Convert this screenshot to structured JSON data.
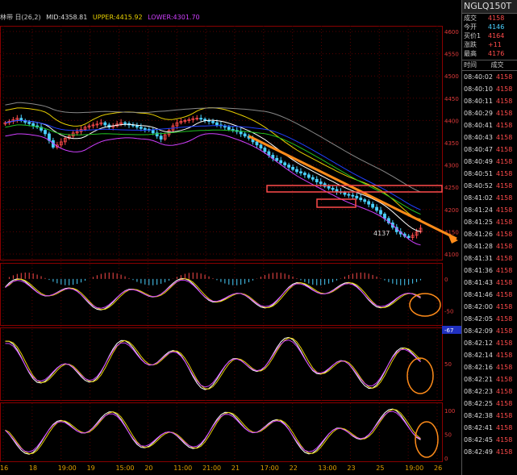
{
  "header": {
    "indicator": "林带 日(26,2)",
    "mid": "MID:4358.81",
    "upper": "UPPER:4415.92",
    "lower": "LOWER:4301.70"
  },
  "quote": {
    "symbol": "NGLQ150T",
    "fields": [
      {
        "label": "成交",
        "value": "4158",
        "color": "#ff4b4b"
      },
      {
        "label": "今开",
        "value": "4146",
        "color": "#4ad0ff"
      },
      {
        "label": "买价1",
        "value": "4164",
        "color": "#ff4b4b"
      },
      {
        "label": "涨跌",
        "value": "+11",
        "color": "#ff4b4b"
      },
      {
        "label": "最高",
        "value": "4176",
        "color": "#ff4b4b"
      }
    ],
    "col_time": "时间",
    "col_trade": "成交",
    "trades": [
      {
        "time": "08:40:02",
        "price": "4158"
      },
      {
        "time": "08:40:10",
        "price": "4158"
      },
      {
        "time": "08:40:11",
        "price": "4158"
      },
      {
        "time": "08:40:29",
        "price": "4158"
      },
      {
        "time": "08:40:41",
        "price": "4158"
      },
      {
        "time": "08:40:43",
        "price": "4158"
      },
      {
        "time": "08:40:47",
        "price": "4158"
      },
      {
        "time": "08:40:49",
        "price": "4158"
      },
      {
        "time": "08:40:51",
        "price": "4158"
      },
      {
        "time": "08:40:52",
        "price": "4158"
      },
      {
        "time": "08:41:02",
        "price": "4158"
      },
      {
        "time": "08:41:24",
        "price": "4158"
      },
      {
        "time": "08:41:25",
        "price": "4158"
      },
      {
        "time": "08:41:26",
        "price": "4158"
      },
      {
        "time": "08:41:28",
        "price": "4158"
      },
      {
        "time": "08:41:31",
        "price": "4158"
      },
      {
        "time": "08:41:36",
        "price": "4158"
      },
      {
        "time": "08:41:43",
        "price": "4158"
      },
      {
        "time": "08:41:46",
        "price": "4158"
      },
      {
        "time": "08:42:00",
        "price": "4158"
      },
      {
        "time": "08:42:05",
        "price": "4158"
      },
      {
        "time": "08:42:09",
        "price": "4158"
      },
      {
        "time": "08:42:12",
        "price": "4158"
      },
      {
        "time": "08:42:14",
        "price": "4158"
      },
      {
        "time": "08:42:16",
        "price": "4158"
      },
      {
        "time": "08:42:21",
        "price": "4158"
      },
      {
        "time": "08:42:23",
        "price": "4158"
      },
      {
        "time": "08:42:25",
        "price": "4158"
      },
      {
        "time": "08:42:38",
        "price": "4158"
      },
      {
        "time": "08:42:41",
        "price": "4158"
      },
      {
        "time": "08:42:45",
        "price": "4158"
      },
      {
        "time": "08:42:49",
        "price": "4158"
      }
    ]
  },
  "chart_data": [
    {
      "type": "candlestick",
      "title": "林带 日(26,2)",
      "ylim": [
        4100,
        4600
      ],
      "yticks": [
        "4600",
        "4550",
        "4500",
        "4450",
        "4400",
        "4350",
        "4300",
        "4250",
        "4200",
        "4150",
        "4100"
      ],
      "close": [
        4395,
        4398,
        4402,
        4405,
        4400,
        4396,
        4393,
        4388,
        4385,
        4378,
        4370,
        4355,
        4340,
        4345,
        4352,
        4360,
        4365,
        4372,
        4375,
        4380,
        4385,
        4388,
        4390,
        4392,
        4395,
        4390,
        4385,
        4388,
        4392,
        4395,
        4393,
        4390,
        4388,
        4385,
        4382,
        4380,
        4378,
        4372,
        4365,
        4358,
        4368,
        4378,
        4388,
        4395,
        4398,
        4400,
        4402,
        4404,
        4405,
        4403,
        4400,
        4398,
        4395,
        4390,
        4388,
        4385,
        4380,
        4378,
        4375,
        4370,
        4365,
        4360,
        4352,
        4345,
        4338,
        4330,
        4322,
        4315,
        4310,
        4305,
        4300,
        4295,
        4290,
        4285,
        4282,
        4278,
        4272,
        4268,
        4262,
        4258,
        4252,
        4248,
        4245,
        4240,
        4238,
        4234,
        4232,
        4230,
        4226,
        4222,
        4218,
        4212,
        4205,
        4198,
        4190,
        4180,
        4170,
        4160,
        4150,
        4145,
        4140,
        4137,
        4142,
        4150,
        4158
      ],
      "annotations": [
        "4137"
      ],
      "bands": [
        "UPPER",
        "MID",
        "LOWER"
      ]
    },
    {
      "type": "line",
      "ylim": [
        -67,
        20
      ],
      "yticks": [
        "0",
        "-50"
      ],
      "corner_label": "-67"
    },
    {
      "type": "line",
      "ylim": [
        0,
        100
      ],
      "yticks": [
        "50"
      ]
    },
    {
      "type": "line",
      "ylim": [
        0,
        110
      ],
      "yticks": [
        "100",
        "50",
        "0"
      ]
    }
  ],
  "xaxis": {
    "ticks": [
      "16",
      "18",
      "19:00",
      "19",
      "15:00",
      "20",
      "11:00",
      "21:00",
      "21",
      "17:00",
      "22",
      "13:00",
      "23",
      "25",
      "19:00",
      "26"
    ]
  },
  "colors": {
    "up": "#ff4b4b",
    "down": "#4ad0ff",
    "trend": "#ff8c1a",
    "box": "#ff4b4b",
    "grid": "#5a0000"
  }
}
